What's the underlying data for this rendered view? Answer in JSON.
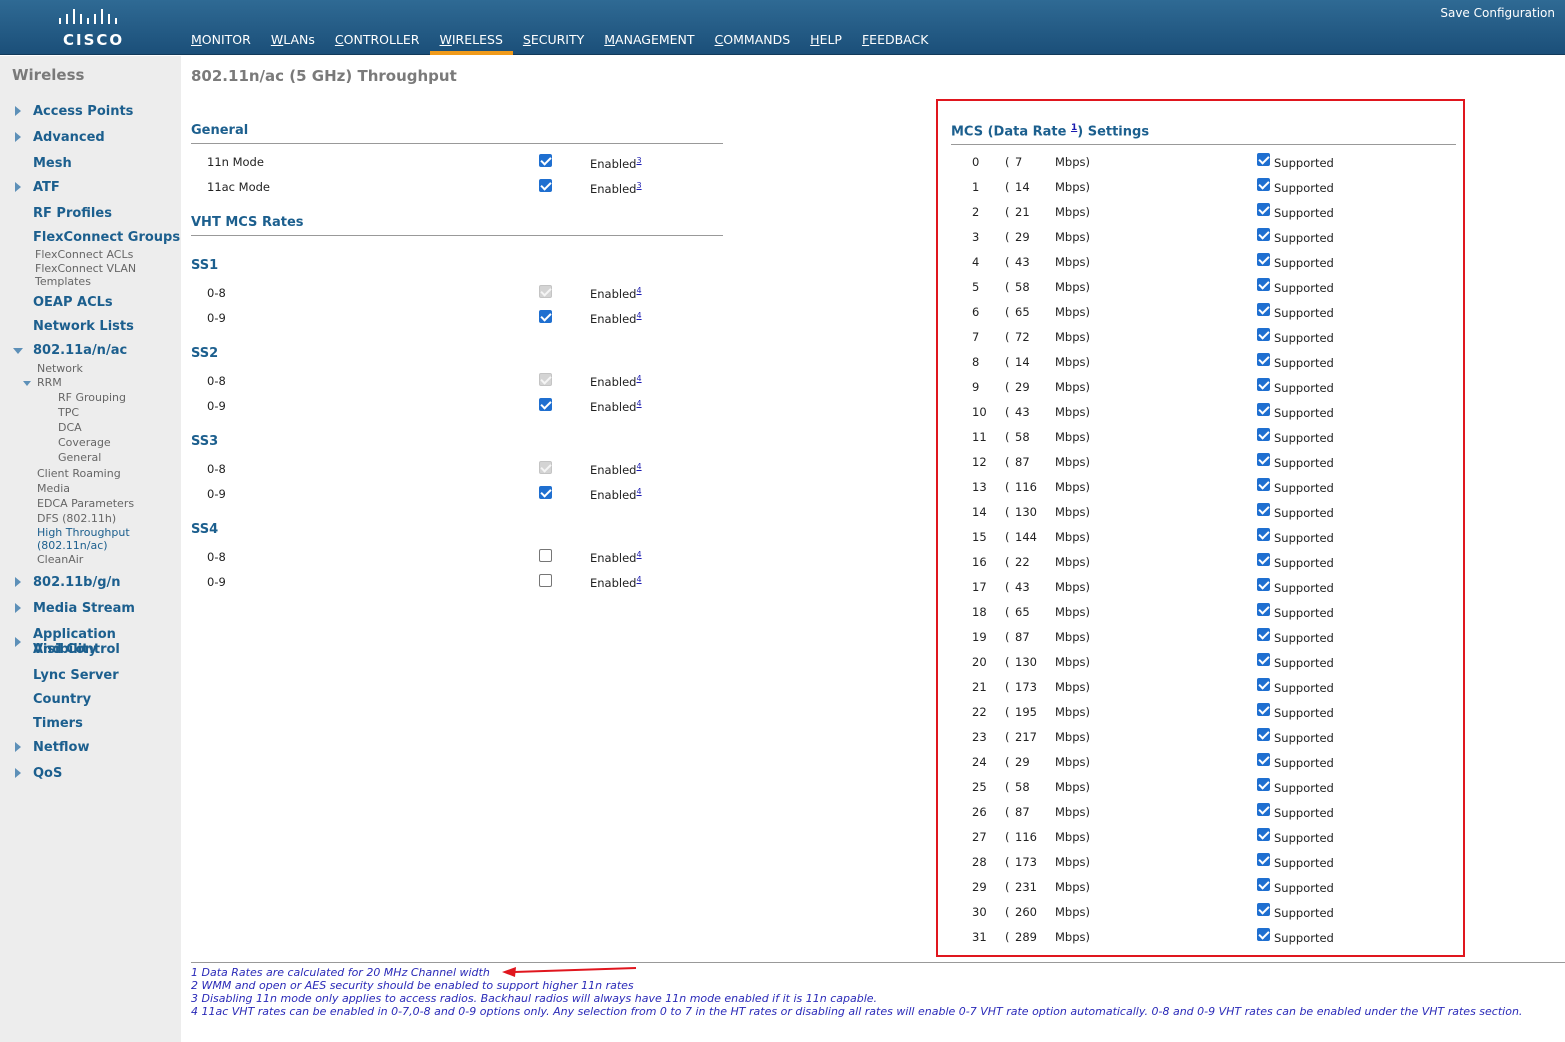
{
  "header": {
    "logo_text": "CISCO",
    "save_config": "Save Configuration",
    "nav": [
      "MONITOR",
      "WLANs",
      "CONTROLLER",
      "WIRELESS",
      "SECURITY",
      "MANAGEMENT",
      "COMMANDS",
      "HELP",
      "FEEDBACK"
    ],
    "active_nav": "WIRELESS",
    "accent_color": "#f09a1a"
  },
  "sidebar": {
    "title": "Wireless",
    "items": {
      "access_points": "Access Points",
      "advanced": "Advanced",
      "mesh": "Mesh",
      "atf": "ATF",
      "rf_profiles": "RF Profiles",
      "flexconnect_groups": "FlexConnect Groups",
      "flexconnect_acls": "FlexConnect ACLs",
      "flexconnect_vlan": "FlexConnect VLAN",
      "templates": "Templates",
      "oeap_acls": "OEAP ACLs",
      "network_lists": "Network Lists",
      "band_a": "802.11a/n/ac",
      "network": "Network",
      "rrm": "RRM",
      "rf_grouping": "RF Grouping",
      "tpc": "TPC",
      "dca": "DCA",
      "coverage": "Coverage",
      "general": "General",
      "client_roaming": "Client Roaming",
      "media": "Media",
      "edca": "EDCA Parameters",
      "dfs": "DFS (802.11h)",
      "high_throughput_1": "High Throughput",
      "high_throughput_2": "(802.11n/ac)",
      "cleanair": "CleanAir",
      "band_b": "802.11b/g/n",
      "media_stream": "Media Stream",
      "avc_1": "Application Visibility",
      "avc_2": "And Control",
      "lync": "Lync Server",
      "country": "Country",
      "timers": "Timers",
      "netflow": "Netflow",
      "qos": "QoS"
    }
  },
  "main": {
    "title": "802.11n/ac (5 GHz) Throughput",
    "general": {
      "heading": "General",
      "rows": [
        {
          "label": "11n Mode",
          "state": "checked",
          "value": "Enabled",
          "note": "3"
        },
        {
          "label": "11ac Mode",
          "state": "checked",
          "value": "Enabled",
          "note": "3"
        }
      ]
    },
    "vht": {
      "heading": "VHT MCS Rates",
      "groups": [
        {
          "name": "SS1",
          "rows": [
            {
              "label": "0-8",
              "state": "disabled",
              "value": "Enabled",
              "note": "4"
            },
            {
              "label": "0-9",
              "state": "checked",
              "value": "Enabled",
              "note": "4"
            }
          ]
        },
        {
          "name": "SS2",
          "rows": [
            {
              "label": "0-8",
              "state": "disabled",
              "value": "Enabled",
              "note": "4"
            },
            {
              "label": "0-9",
              "state": "checked",
              "value": "Enabled",
              "note": "4"
            }
          ]
        },
        {
          "name": "SS3",
          "rows": [
            {
              "label": "0-8",
              "state": "disabled",
              "value": "Enabled",
              "note": "4"
            },
            {
              "label": "0-9",
              "state": "checked",
              "value": "Enabled",
              "note": "4"
            }
          ]
        },
        {
          "name": "SS4",
          "rows": [
            {
              "label": "0-8",
              "state": "unchecked",
              "value": "Enabled",
              "note": "4"
            },
            {
              "label": "0-9",
              "state": "unchecked",
              "value": "Enabled",
              "note": "4"
            }
          ]
        }
      ]
    },
    "mcs": {
      "heading_pre": "MCS (Data Rate ",
      "heading_note": "1",
      "heading_post": ") Settings",
      "paren": "(",
      "unit": "Mbps)",
      "supported_label": "Supported",
      "rows": [
        {
          "index": "0",
          "rate": "7"
        },
        {
          "index": "1",
          "rate": "14"
        },
        {
          "index": "2",
          "rate": "21"
        },
        {
          "index": "3",
          "rate": "29"
        },
        {
          "index": "4",
          "rate": "43"
        },
        {
          "index": "5",
          "rate": "58"
        },
        {
          "index": "6",
          "rate": "65"
        },
        {
          "index": "7",
          "rate": "72"
        },
        {
          "index": "8",
          "rate": "14"
        },
        {
          "index": "9",
          "rate": "29"
        },
        {
          "index": "10",
          "rate": "43"
        },
        {
          "index": "11",
          "rate": "58"
        },
        {
          "index": "12",
          "rate": "87"
        },
        {
          "index": "13",
          "rate": "116"
        },
        {
          "index": "14",
          "rate": "130"
        },
        {
          "index": "15",
          "rate": "144"
        },
        {
          "index": "16",
          "rate": "22"
        },
        {
          "index": "17",
          "rate": "43"
        },
        {
          "index": "18",
          "rate": "65"
        },
        {
          "index": "19",
          "rate": "87"
        },
        {
          "index": "20",
          "rate": "130"
        },
        {
          "index": "21",
          "rate": "173"
        },
        {
          "index": "22",
          "rate": "195"
        },
        {
          "index": "23",
          "rate": "217"
        },
        {
          "index": "24",
          "rate": "29"
        },
        {
          "index": "25",
          "rate": "58"
        },
        {
          "index": "26",
          "rate": "87"
        },
        {
          "index": "27",
          "rate": "116"
        },
        {
          "index": "28",
          "rate": "173"
        },
        {
          "index": "29",
          "rate": "231"
        },
        {
          "index": "30",
          "rate": "260"
        },
        {
          "index": "31",
          "rate": "289"
        }
      ]
    },
    "footnotes": [
      "1 Data Rates are calculated for 20 MHz Channel width",
      "2 WMM and open or AES security should be enabled to support higher 11n rates",
      "3 Disabling 11n mode only applies to access radios. Backhaul radios will always have 11n mode enabled if it is 11n capable.",
      "4 11ac VHT rates can be enabled in 0-7,0-8 and 0-9 options only. Any selection from 0 to 7 in the HT rates or disabling all rates will enable 0-7 VHT rate option automatically. 0-8 and 0-9 VHT rates can be enabled under the VHT rates section."
    ],
    "annotation_color": "#e0161e"
  }
}
